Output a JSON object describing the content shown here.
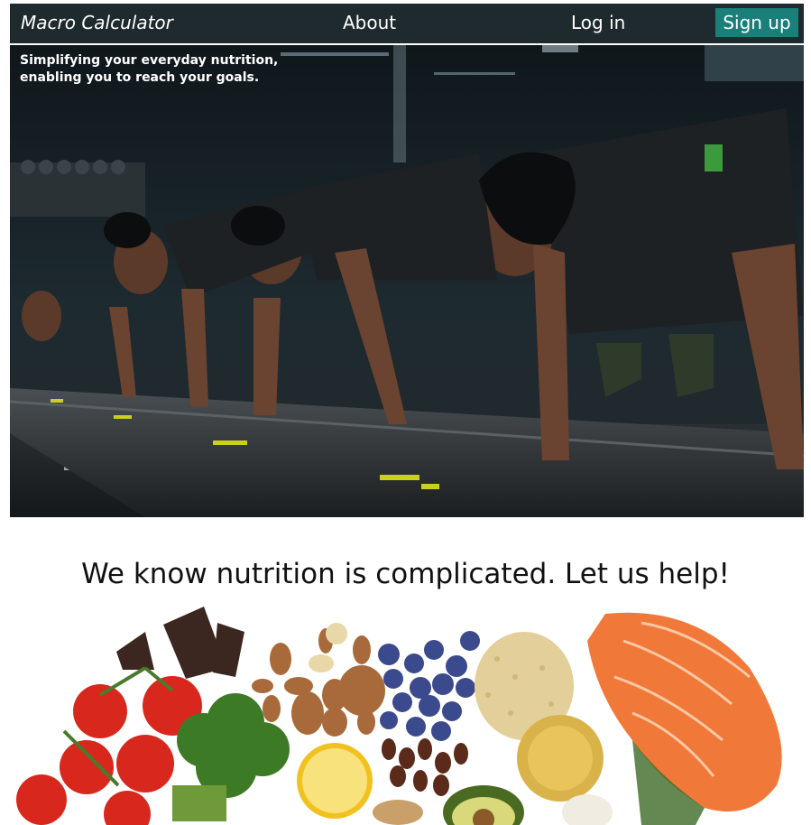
{
  "navbar": {
    "brand": "Macro Calculator",
    "about": "About",
    "login": "Log in",
    "signup": "Sign up"
  },
  "hero": {
    "tagline": "Simplifying your everyday nutrition, enabling you to reach your goals."
  },
  "section": {
    "heading": "We know nutrition is complicated. Let us help!"
  },
  "colors": {
    "navbar_bg": "#1e2a2d",
    "signup_bg": "#1a7f79",
    "text_dark": "#111111"
  }
}
